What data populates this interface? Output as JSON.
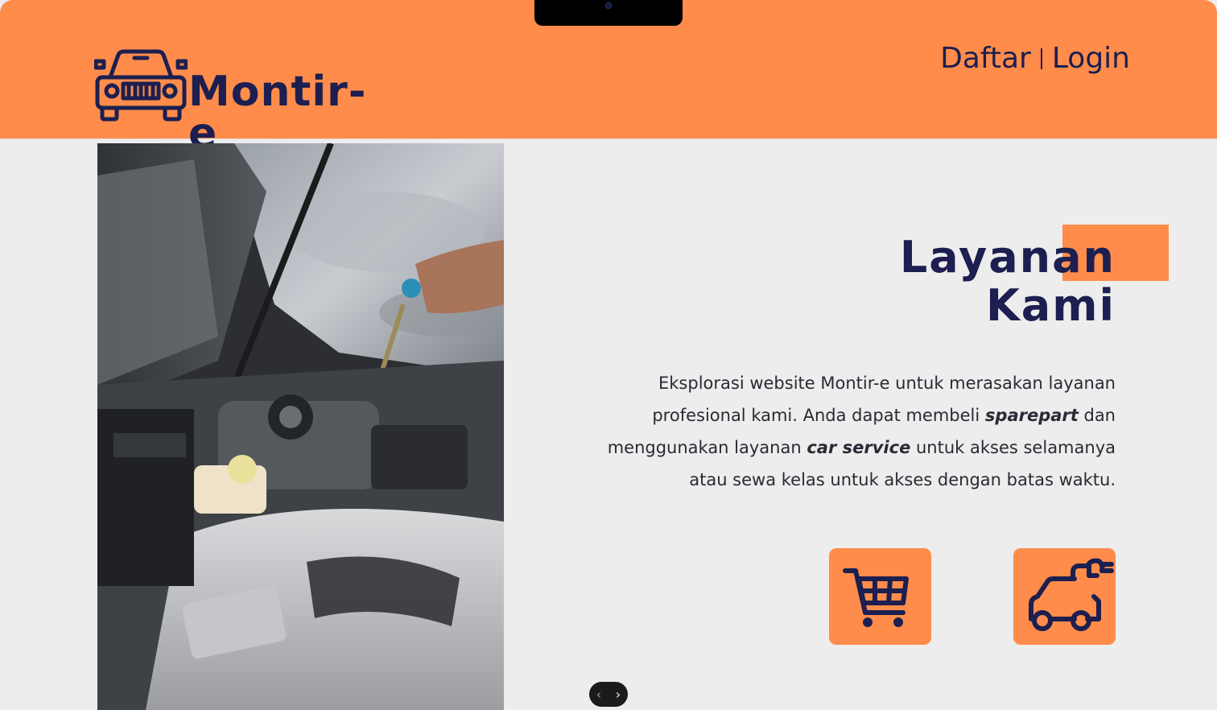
{
  "header": {
    "brand": "Montir-e",
    "nav": {
      "register": "Daftar",
      "login": "Login"
    }
  },
  "hero": {
    "title_line1": "Layanan",
    "title_line2": "Kami",
    "description": {
      "part1": "Eksplorasi website Montir-e untuk merasakan layanan profesional kami. Anda dapat membeli ",
      "em1": "sparepart",
      "part2": " dan menggunakan layanan ",
      "em2": "car service",
      "part3": " untuk akses selamanya atau sewa kelas untuk akses dengan batas waktu."
    }
  },
  "services": [
    {
      "icon": "shopping-cart-icon"
    },
    {
      "icon": "car-repair-wrench-icon"
    }
  ],
  "pager": {
    "prev": "‹",
    "next": "›"
  },
  "colors": {
    "accent": "#ff8c4b",
    "navy": "#1c1f4f",
    "background": "#ededed"
  }
}
